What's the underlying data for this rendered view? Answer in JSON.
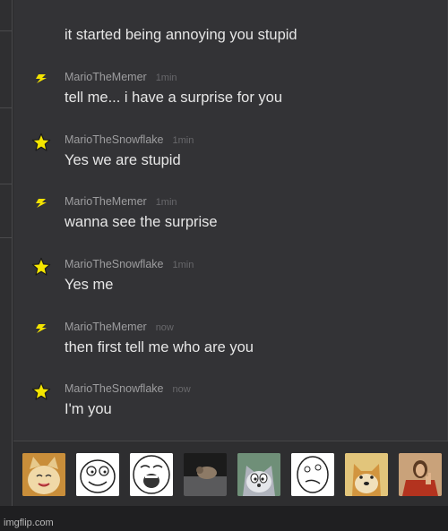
{
  "messages": [
    {
      "username": "",
      "timestamp": "",
      "text": "it started being annoying you stupid",
      "avatar": "none"
    },
    {
      "username": "MarioTheMemer",
      "timestamp": "1min",
      "text": "tell me... i have a surprise for you",
      "avatar": "lightning-icon"
    },
    {
      "username": "MarioTheSnowflake",
      "timestamp": "1min",
      "text": "Yes we are stupid",
      "avatar": "star-icon"
    },
    {
      "username": "MarioTheMemer",
      "timestamp": "1min",
      "text": "wanna see the surprise",
      "avatar": "lightning-icon"
    },
    {
      "username": "MarioTheSnowflake",
      "timestamp": "1min",
      "text": "Yes me",
      "avatar": "star-icon"
    },
    {
      "username": "MarioTheMemer",
      "timestamp": "now",
      "text": "then first tell me who are you",
      "avatar": "lightning-icon"
    },
    {
      "username": "MarioTheSnowflake",
      "timestamp": "now",
      "text": "I'm you",
      "avatar": "star-icon"
    }
  ],
  "meme_tray": {
    "thumbnails": [
      "happy-cat-meme",
      "rage-face-meme",
      "lol-face-meme",
      "dark-meme",
      "tom-cat-meme",
      "derp-face-meme",
      "doge-meme",
      "buddy-christ-meme"
    ]
  },
  "footer": {
    "watermark": "imgflip.com"
  },
  "colors": {
    "star": "#f5e600",
    "lightning": "#f2e200",
    "username": "#9d9d9f",
    "timestamp": "#68686b",
    "text": "#e6e6e6"
  }
}
